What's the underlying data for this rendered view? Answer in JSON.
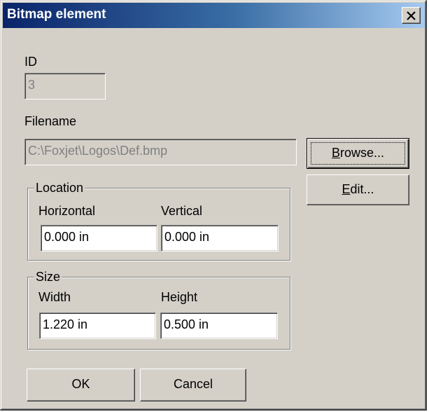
{
  "window": {
    "title": "Bitmap element"
  },
  "id_field": {
    "label": "ID",
    "value": "3"
  },
  "filename_field": {
    "label": "Filename",
    "value": "C:\\Foxjet\\Logos\\Def.bmp"
  },
  "browse_button": {
    "accel": "B",
    "rest": "rowse..."
  },
  "edit_button": {
    "accel": "E",
    "rest": "dit..."
  },
  "location": {
    "label": "Location",
    "horizontal_label": "Horizontal",
    "horizontal_value": "0.000 in",
    "vertical_label": "Vertical",
    "vertical_value": "0.000 in"
  },
  "size": {
    "label": "Size",
    "width_label": "Width",
    "width_value": "1.220 in",
    "height_label": "Height",
    "height_value": "0.500 in"
  },
  "buttons": {
    "ok": "OK",
    "cancel": "Cancel"
  }
}
